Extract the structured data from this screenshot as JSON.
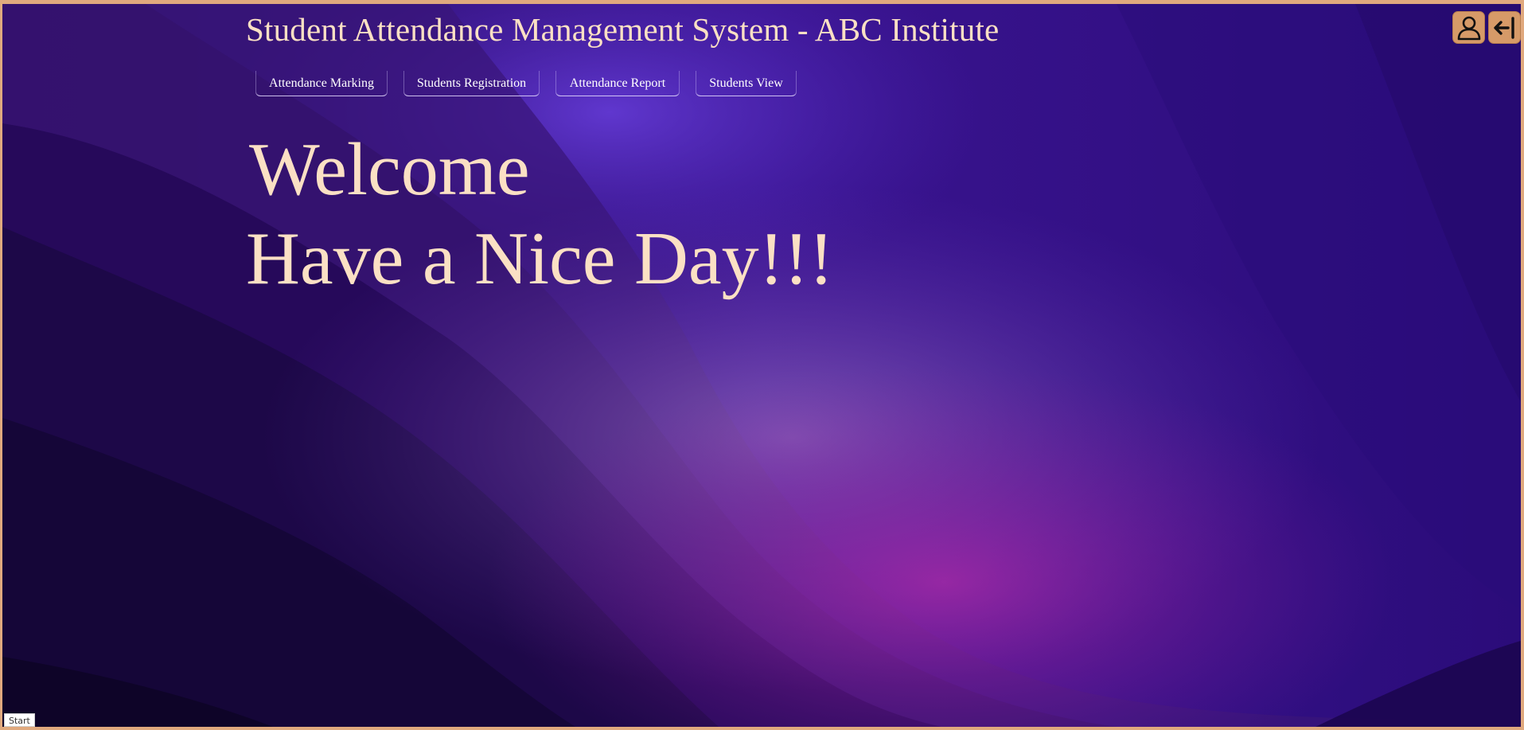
{
  "header": {
    "title": "Student Attendance Management System - ABC Institute"
  },
  "nav": {
    "items": [
      {
        "label": "Attendance Marking"
      },
      {
        "label": "Students Registration"
      },
      {
        "label": "Attendance Report"
      },
      {
        "label": "Students View"
      }
    ]
  },
  "main": {
    "welcome": "Welcome",
    "greeting": "Have a Nice Day!!!"
  },
  "toolbar": {
    "profile_icon": "user-icon",
    "logout_icon": "logout-icon"
  },
  "status_bar": {
    "text": "Start"
  },
  "colors": {
    "accent": "#d69a68",
    "text": "#fbe0c4",
    "border": "#e0a97e"
  }
}
